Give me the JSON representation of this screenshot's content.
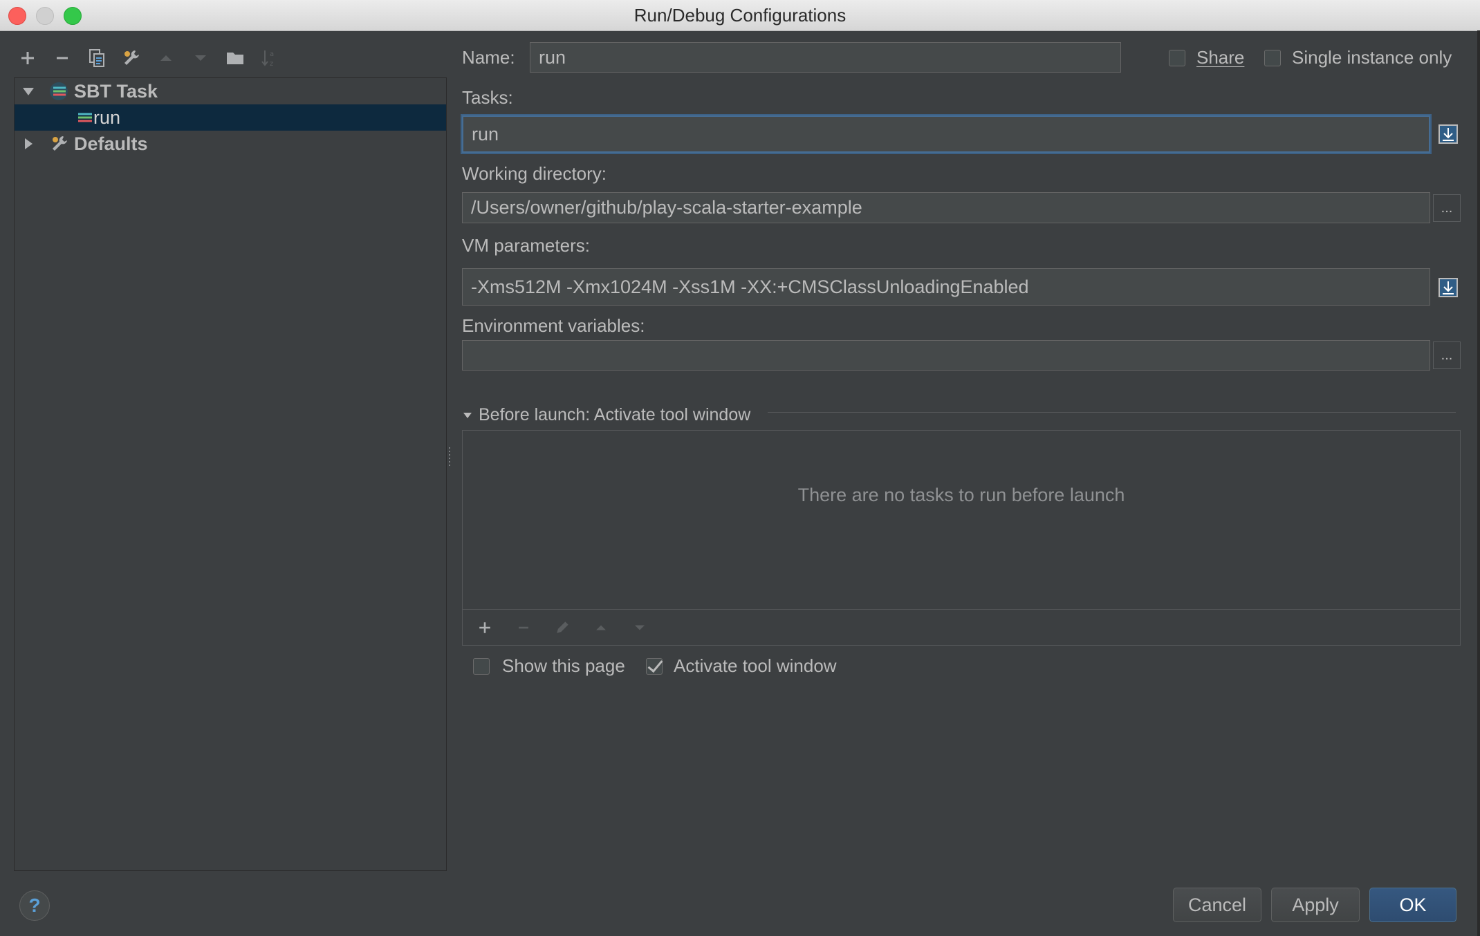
{
  "window": {
    "title": "Run/Debug Configurations"
  },
  "left_toolbar": {
    "icons": [
      "add-icon",
      "remove-icon",
      "copy-icon",
      "wrench-icon",
      "move-up-icon",
      "move-down-icon",
      "folder-icon",
      "sort-alpha-icon"
    ]
  },
  "tree": {
    "items": [
      {
        "label": "SBT Task",
        "expanded": true,
        "icon": "sbt-icon"
      },
      {
        "label": "run",
        "selected": true,
        "icon": "sbt-run-icon"
      },
      {
        "label": "Defaults",
        "expanded": false,
        "icon": "wrench-icon"
      }
    ]
  },
  "form": {
    "name_label": "Name:",
    "name_value": "run",
    "share_label": "Share",
    "share_checked": false,
    "single_instance_label": "Single instance only",
    "single_instance_checked": false,
    "tasks_label": "Tasks:",
    "tasks_value": "run",
    "working_dir_label": "Working directory:",
    "working_dir_value": "/Users/owner/github/play-scala-starter-example",
    "vm_params_label": "VM parameters:",
    "vm_params_value": "-Xms512M -Xmx1024M -Xss1M -XX:+CMSClassUnloadingEnabled",
    "env_vars_label": "Environment variables:",
    "env_vars_value": "",
    "browse_label": "..."
  },
  "before_launch": {
    "header": "Before launch: Activate tool window",
    "empty_text": "There are no tasks to run before launch",
    "show_page_label": "Show this page",
    "show_page_checked": false,
    "activate_tool_label": "Activate tool window",
    "activate_tool_checked": true
  },
  "buttons": {
    "help": "?",
    "cancel": "Cancel",
    "apply": "Apply",
    "ok": "OK"
  },
  "colors": {
    "background": "#3c3f41",
    "selection": "#0d293e",
    "primary_button": "#365880",
    "focus_border": "#466d94"
  }
}
